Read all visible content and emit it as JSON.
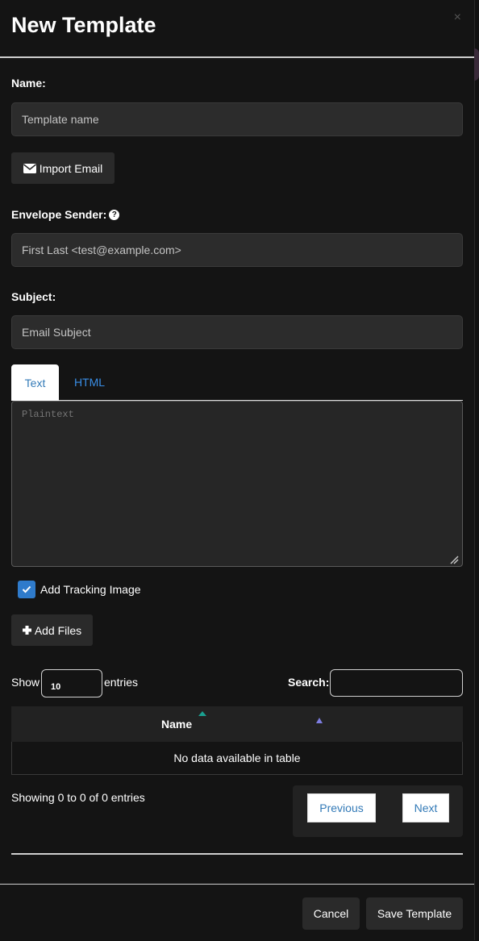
{
  "modal": {
    "title": "New Template",
    "close_label": "×"
  },
  "form": {
    "name_label": "Name:",
    "name_placeholder": "Template name",
    "name_value": "",
    "import_email_label": "Import Email",
    "envelope_sender_label": "Envelope Sender:",
    "envelope_sender_help_icon": "question-circle-icon",
    "envelope_sender_placeholder": "First Last <test@example.com>",
    "envelope_sender_value": "",
    "subject_label": "Subject:",
    "subject_placeholder": "Email Subject",
    "subject_value": ""
  },
  "editor": {
    "tabs": [
      {
        "label": "Text",
        "active": true
      },
      {
        "label": "HTML",
        "active": false
      }
    ],
    "placeholder": "Plaintext",
    "value": ""
  },
  "tracking": {
    "label": "Add Tracking Image",
    "checked": true
  },
  "attachments": {
    "add_files_label": "Add Files",
    "show_label": "Show",
    "length_value": "10",
    "entries_label": "entries",
    "search_label": "Search:",
    "search_value": "",
    "columns": [
      "Name"
    ],
    "empty_message": "No data available in table",
    "info": "Showing 0 to 0 of 0 entries",
    "previous_label": "Previous",
    "next_label": "Next"
  },
  "footer": {
    "cancel_label": "Cancel",
    "save_label": "Save Template"
  },
  "colors": {
    "background": "#141414",
    "input_bg": "#2c2c2c",
    "button_bg": "#2a2a2a",
    "link_blue": "#337ab7",
    "checkbox_blue": "#2f7bcb"
  }
}
